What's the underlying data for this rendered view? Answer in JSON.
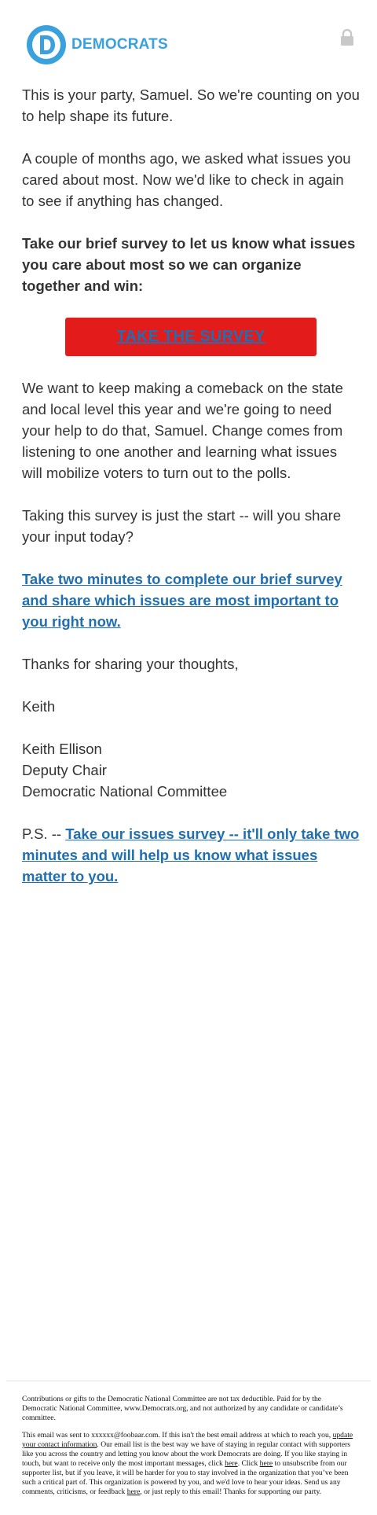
{
  "header": {
    "logo_text": "DEMOCRATS",
    "logo_icon": "democrats-d-logo",
    "lock_icon": "lock-icon",
    "brand_color": "#3aa1dd"
  },
  "body": {
    "p1": "This is your party, Samuel. So we're counting on you to help shape its future.",
    "p2": "A couple of months ago, we asked what issues you cared about most. Now we'd like to check in again to see if anything has changed.",
    "p3": "Take our brief survey to let us know what issues you care about most so we can organize together and win:",
    "cta_label": "TAKE THE SURVEY",
    "cta_color": "#e31b1b",
    "p4": "We want to keep making a comeback on the state and local level this year and we're going to need your help to do that, Samuel. Change comes from listening to one another and learning what issues will mobilize voters to turn out to the polls.",
    "p5": "Taking this survey is just the start -- will you share your input today?",
    "link1": "Take two minutes to complete our brief survey and share which issues are most important to you right now.",
    "p6": "Thanks for sharing your thoughts,",
    "sign_first": "Keith",
    "sig_name": "Keith Ellison",
    "sig_title": "Deputy Chair",
    "sig_org": "Democratic National Committee",
    "ps_prefix": "P.S. -- ",
    "ps_link": "Take our issues survey -- it'll only take two minutes and will help us know what issues matter to you.",
    "link_color": "#1f6fb2"
  },
  "footer": {
    "disclaimer": "Contributions or gifts to the Democratic National Committee are not tax deductible. Paid for by the Democratic National Committee, www.Democrats.org, and not authorized by any candidate or candidate’s committee.",
    "sent_prefix": "This email was sent to xxxxxx@foobaar.com. If this isn't the best email address at which to reach you, ",
    "update_link": "update your contact information",
    "sent_mid1": ". Our email list is the best way we have of staying in regular contact with supporters like you across the country and letting you know about the work Democrats are doing. If you like staying in touch, but want to receive only the most important messages, click ",
    "here1": "here",
    "sent_mid2": ". Click ",
    "here2": "here",
    "sent_mid3": " to unsubscribe from our supporter list, but if you leave, it will be harder for you to stay involved in the organization that you’ve been such a critical part of. This organization is powered by you, and we'd love to hear your ideas. Send us any comments, criticisms, or feedback ",
    "here3": "here",
    "sent_end": ", or just reply to this email! Thanks for supporting our party."
  }
}
